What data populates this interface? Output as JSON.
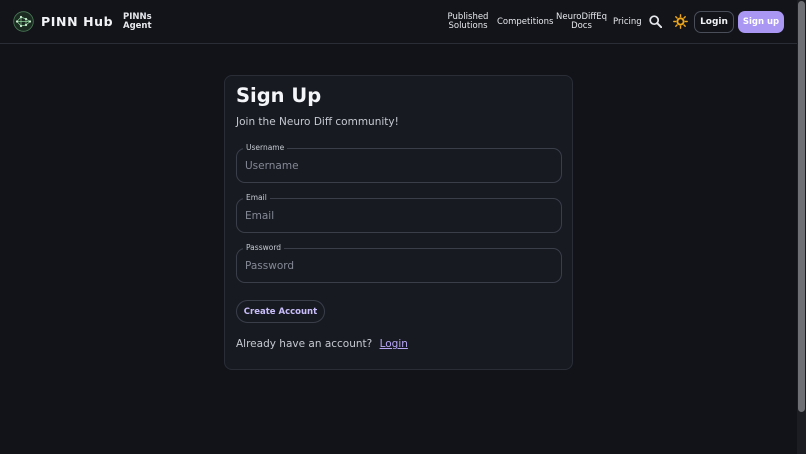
{
  "nav": {
    "brand": "PINN Hub",
    "agent_link": "PINNs Agent",
    "links": [
      {
        "label": "Published Solutions"
      },
      {
        "label": "Competitions"
      },
      {
        "label": "NeuroDiffEq Docs"
      },
      {
        "label": "Pricing"
      }
    ],
    "login_label": "Login",
    "signup_label": "Sign up",
    "accent_color": "#a997f3",
    "theme_icon_color": "#f0a81a"
  },
  "form": {
    "title": "Sign Up",
    "subtitle": "Join the Neuro Diff community!",
    "fields": [
      {
        "label": "Username",
        "placeholder": "Username",
        "value": ""
      },
      {
        "label": "Email",
        "placeholder": "Email",
        "value": ""
      },
      {
        "label": "Password",
        "placeholder": "Password",
        "value": ""
      }
    ],
    "submit_label": "Create Account",
    "already_text": "Already have an account?",
    "login_link": "Login"
  },
  "icons": {
    "logo": "pinn-hub-logo-icon",
    "search": "search-icon",
    "theme": "sun-theme-icon"
  }
}
